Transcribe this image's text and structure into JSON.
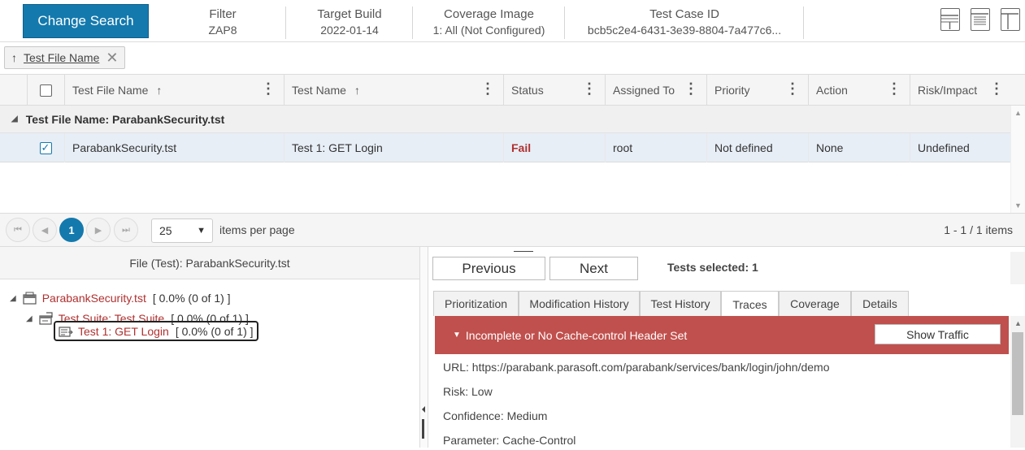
{
  "header": {
    "change_search": "Change Search",
    "filter": {
      "label": "Filter",
      "value": "ZAP8"
    },
    "target_build": {
      "label": "Target Build",
      "value": "2022-01-14"
    },
    "coverage_image": {
      "label": "Coverage Image",
      "value": "1: All (Not Configured)"
    },
    "test_case_id": {
      "label": "Test Case ID",
      "value": "bcb5c2e4-6431-3e39-8804-7a477c6..."
    }
  },
  "sort_chip": {
    "label": "Test File Name",
    "arrow": "↑",
    "close": "✕"
  },
  "grid": {
    "columns": [
      "Test File Name",
      "Test Name",
      "Status",
      "Assigned To",
      "Priority",
      "Action",
      "Risk/Impact"
    ],
    "sort_arrow": "↑",
    "menu_glyph": "⋮",
    "group_label": "Test File Name: ParabankSecurity.tst",
    "rows": [
      {
        "test_file_name": "ParabankSecurity.tst",
        "test_name": "Test 1: GET Login",
        "status": "Fail",
        "assigned_to": "root",
        "priority": "Not defined",
        "action": "None",
        "risk_impact": "Undefined"
      }
    ]
  },
  "pager": {
    "first": "⏮",
    "prev": "◀",
    "current_page": "1",
    "next": "▶",
    "last": "⏭",
    "page_size": "25",
    "items_per_page": "items per page",
    "count": "1 - 1 / 1 items"
  },
  "left_panel": {
    "title": "File (Test): ParabankSecurity.tst",
    "tree": [
      {
        "name": "ParabankSecurity.tst",
        "pct": "[ 0.0% (0 of 1) ]"
      },
      {
        "name": "Test Suite: Test Suite",
        "pct": "[ 0.0% (0 of 1) ]"
      },
      {
        "name": "Test 1: GET Login",
        "pct": "[ 0.0% (0 of 1) ]"
      }
    ]
  },
  "right_panel": {
    "previous": "Previous",
    "next": "Next",
    "tests_selected": "Tests selected: 1",
    "tabs": [
      "Prioritization",
      "Modification History",
      "Test History",
      "Traces",
      "Coverage",
      "Details"
    ],
    "active_tab": "Traces",
    "trace_title": "Incomplete or No Cache-control Header Set",
    "show_traffic": "Show Traffic",
    "details": [
      "URL: https://parabank.parasoft.com/parabank/services/bank/login/john/demo",
      "Risk: Low",
      "Confidence: Medium",
      "Parameter: Cache-Control"
    ]
  },
  "colors": {
    "primary": "#1479ad",
    "fail": "#b03030",
    "trace_bar": "#c0504d"
  }
}
